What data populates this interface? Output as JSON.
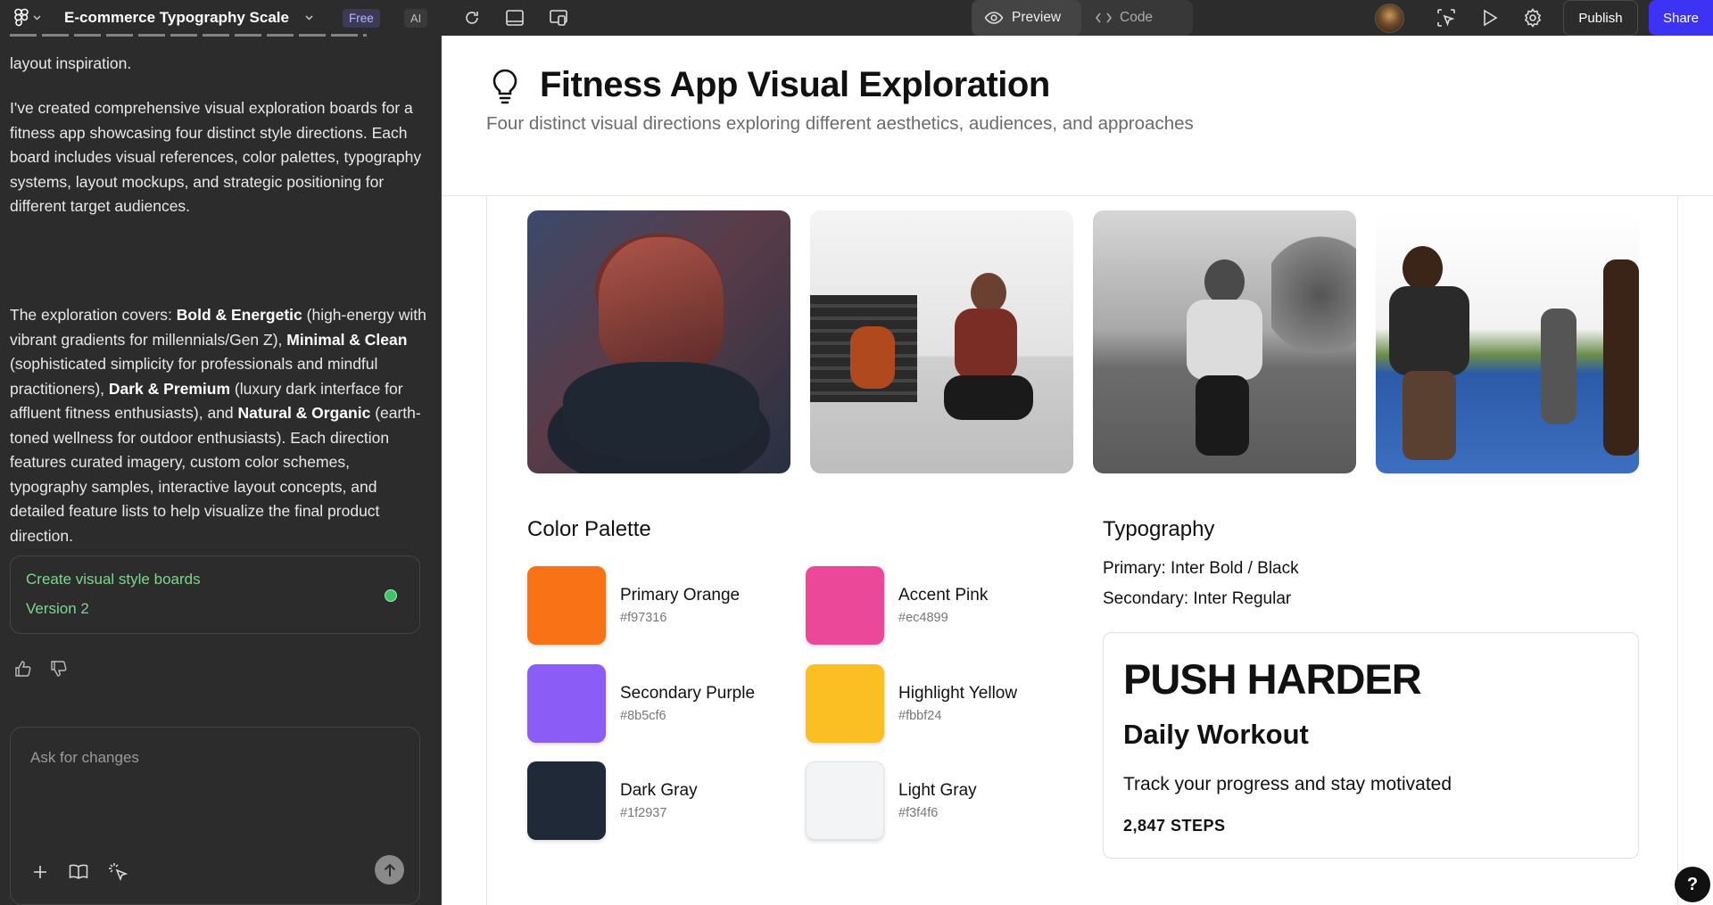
{
  "topbar": {
    "project_title": "E-commerce Typography Scale",
    "plan_badge": "Free",
    "ai_badge": "AI",
    "preview_label": "Preview",
    "code_label": "Code",
    "publish_label": "Publish",
    "share_label": "Share"
  },
  "chat": {
    "partial_line": "layout inspiration.",
    "para1": "I've created comprehensive visual exploration boards for a fitness app showcasing four distinct style directions. Each board includes visual references, color palettes, typography systems, layout mockups, and strategic positioning for different target audiences.",
    "p2_intro": "The exploration covers: ",
    "p2_b1": "Bold & Energetic",
    "p2_t1": " (high-energy with vibrant gradients for millennials/Gen Z), ",
    "p2_b2": "Minimal & Clean",
    "p2_t2": " (sophisticated simplicity for professionals and mindful practitioners), ",
    "p2_b3": "Dark & Premium",
    "p2_t3": " (luxury dark interface for affluent fitness enthusiasts), and ",
    "p2_b4": "Natural & Organic",
    "p2_t4": " (earth-toned wellness for outdoor enthusiasts). Each direction features curated imagery, custom color schemes, typography samples, interactive layout concepts, and detailed feature lists to help visualize the final product direction.",
    "version_title": "Create visual style boards",
    "version_label": "Version 2",
    "input_placeholder": "Ask for changes"
  },
  "page": {
    "title": "Fitness App Visual Exploration",
    "subtitle": "Four distinct visual directions exploring different aesthetics, audiences, and approaches"
  },
  "palette": {
    "heading": "Color Palette",
    "colors": [
      {
        "name": "Primary Orange",
        "hex": "#f97316"
      },
      {
        "name": "Accent Pink",
        "hex": "#ec4899"
      },
      {
        "name": "Secondary Purple",
        "hex": "#8b5cf6"
      },
      {
        "name": "Highlight Yellow",
        "hex": "#fbbf24"
      },
      {
        "name": "Dark Gray",
        "hex": "#1f2937"
      },
      {
        "name": "Light Gray",
        "hex": "#f3f4f6"
      }
    ]
  },
  "typography": {
    "heading": "Typography",
    "primary": "Primary: Inter Bold / Black",
    "secondary": "Secondary: Inter Regular",
    "sample_display": "PUSH HARDER",
    "sample_heading": "Daily Workout",
    "sample_body": "Track your progress and stay motivated",
    "sample_stat": "2,847 STEPS"
  },
  "help_label": "?"
}
